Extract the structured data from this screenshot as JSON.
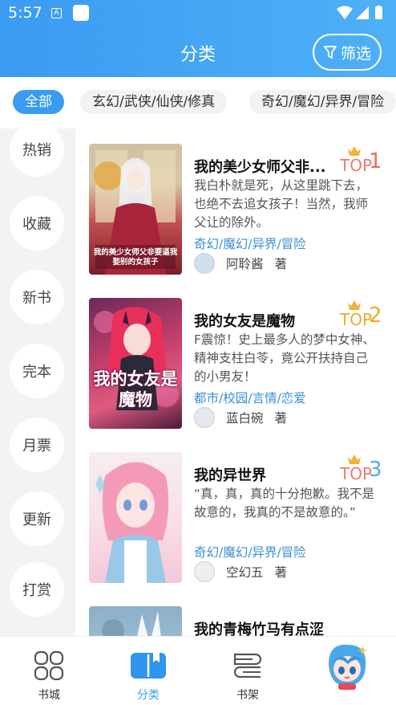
{
  "status_bar": {
    "time": "5:57",
    "a_icon": "A"
  },
  "header": {
    "title": "分类",
    "filter_label": "筛选"
  },
  "category_tabs": [
    {
      "label": "全部",
      "active": true
    },
    {
      "label": "玄幻/武侠/仙侠/修真",
      "active": false
    },
    {
      "label": "奇幻/魔幻/异界/冒险",
      "active": false
    }
  ],
  "sidebar": [
    {
      "label": "热销"
    },
    {
      "label": "收藏"
    },
    {
      "label": "新书"
    },
    {
      "label": "完本"
    },
    {
      "label": "月票"
    },
    {
      "label": "更新"
    },
    {
      "label": "打赏"
    }
  ],
  "books": [
    {
      "title": "我的美少女师父非...",
      "description": "我白朴就是死，从这里跳下去，也绝不去追女孩子！当然，我师父让的除外。",
      "tags": "奇幻/魔幻/异界/冒险",
      "author": "阿聆酱",
      "author_suffix": "著",
      "rank_label": "TOP",
      "rank": "1",
      "rank_color": "#ef6a5a",
      "cover_text": "我的美少女师父非要逼我娶别的女孩子"
    },
    {
      "title": "我的女友是魔物",
      "description": "F震惊！史上最多人的梦中女神、精神支柱白苓，竟公开扶持自己的小男友！",
      "tags": "都市/校园/言情/恋爱",
      "author": "蓝白碗",
      "author_suffix": "著",
      "rank_label": "TOP",
      "rank": "2",
      "rank_color": "#f0a830",
      "cover_text": "我的女友是魔物"
    },
    {
      "title": "我的异世界",
      "description": "“真，真，真的十分抱歉。我不是故意的，我真的不是故意的。”",
      "tags": "奇幻/魔幻/异界/冒险",
      "author": "空幻五",
      "author_suffix": "著",
      "rank_label": "TOP",
      "rank": "3",
      "rank_color": "#5aa8e6",
      "cover_text": ""
    },
    {
      "title": "我的青梅竹马有点涩",
      "description": "",
      "tags": "",
      "author": "",
      "author_suffix": "",
      "rank_label": "",
      "rank": "",
      "cover_text": ""
    }
  ],
  "bottom_nav": [
    {
      "label": "书城",
      "icon": "bookstore-icon",
      "active": false
    },
    {
      "label": "分类",
      "icon": "category-icon",
      "active": true
    },
    {
      "label": "书架",
      "icon": "bookshelf-icon",
      "active": false
    }
  ],
  "colors": {
    "accent": "#3a9bf2",
    "tag": "#3a8fd6"
  }
}
